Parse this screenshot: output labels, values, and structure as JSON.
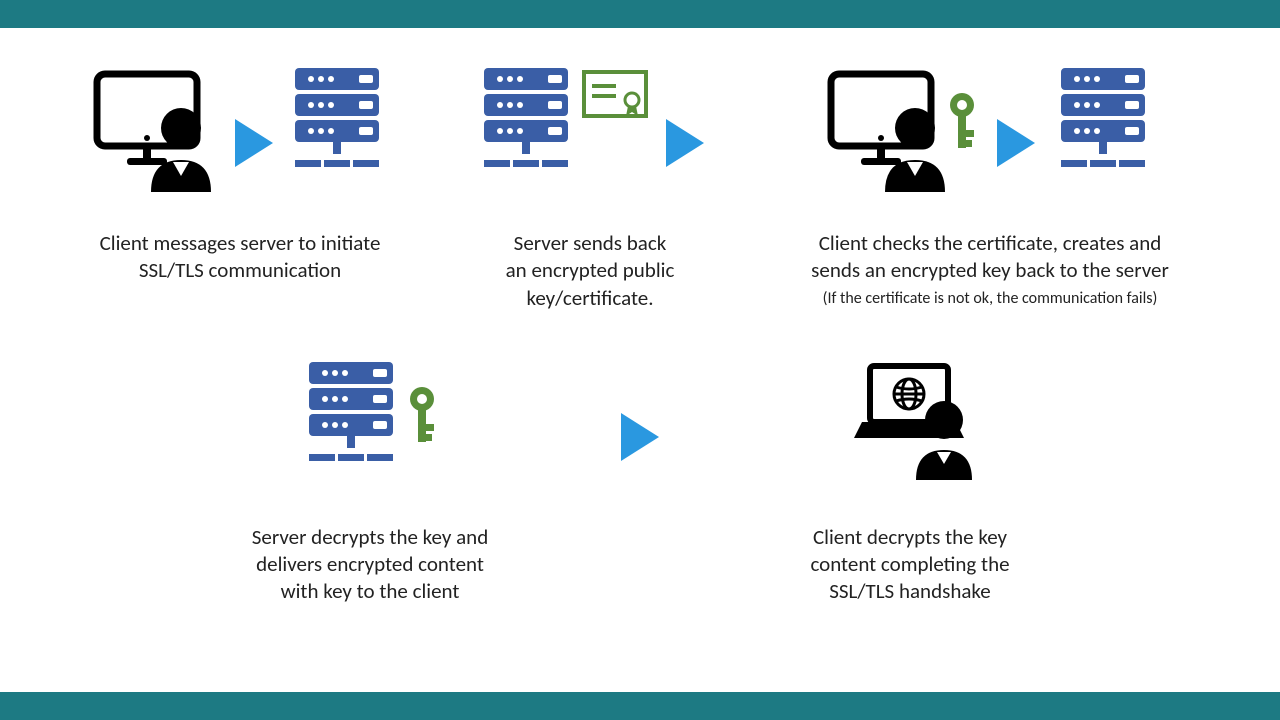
{
  "colors": {
    "bar": "#1d7a83",
    "server": "#3a5ea6",
    "arrow": "#2a98e0",
    "key": "#5a8f3a",
    "cert_border": "#5a8f3a",
    "person": "#000000",
    "text": "#222222"
  },
  "steps": {
    "s1": {
      "caption": "Client messages server to initiate\nSSL/TLS communication"
    },
    "s2": {
      "caption": "Server sends back\nan encrypted public\nkey/certificate."
    },
    "s3": {
      "caption": "Client checks the certificate, creates and\nsends an encrypted key back to the server",
      "sub": "(If the certificate is not ok, the communication fails)"
    },
    "s4": {
      "caption": "Server decrypts the key and\ndelivers encrypted content\nwith key to the client"
    },
    "s5": {
      "caption": "Client decrypts the key\ncontent completing the\nSSL/TLS handshake"
    }
  }
}
